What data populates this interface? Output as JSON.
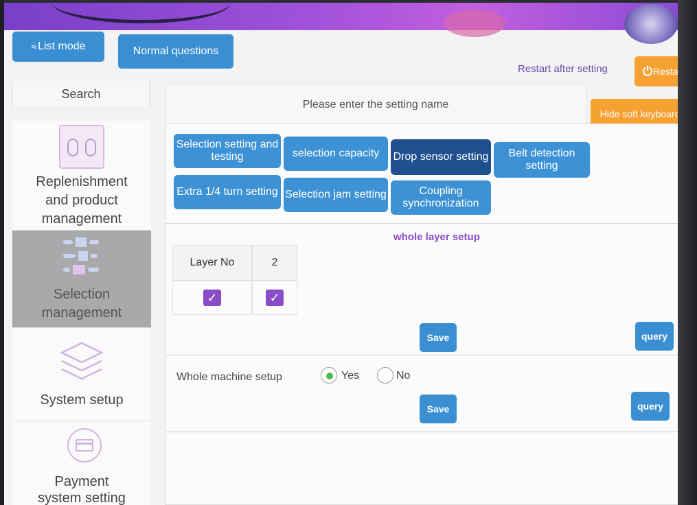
{
  "header": {
    "list_mode_label": "List mode",
    "normal_questions_label": "Normal questions",
    "restart_hint": "Restart after setting",
    "restart_label": "Restart",
    "hide_keyboard_label": "Hide soft keyboard"
  },
  "search": {
    "label": "Search",
    "placeholder": "Please enter the setting name"
  },
  "sidebar": {
    "items": [
      {
        "label": "Replenishment and product management",
        "icon": "device-icon"
      },
      {
        "label": "Selection management",
        "icon": "slots-icon",
        "active": true
      },
      {
        "label": "System setup",
        "icon": "layers-icon"
      },
      {
        "label": "Payment system setting",
        "icon": "card-icon"
      }
    ]
  },
  "tabs": [
    {
      "label": "Selection setting and testing"
    },
    {
      "label": "selection capacity"
    },
    {
      "label": "Drop sensor setting",
      "active": true
    },
    {
      "label": "Belt detection setting"
    },
    {
      "label": "Extra 1/4 turn setting"
    },
    {
      "label": "Selection jam setting"
    },
    {
      "label": "Coupling synchronization"
    }
  ],
  "layer_section": {
    "title": "whole layer setup",
    "col_header": "Layer No",
    "col_value": "2",
    "save_label": "Save",
    "query_label": "query"
  },
  "machine_section": {
    "label": "Whole machine setup",
    "yes_label": "Yes",
    "no_label": "No",
    "selected": "Yes",
    "save_label": "Save",
    "query_label": "query"
  },
  "colors": {
    "accent_blue": "#3a8fd3",
    "active_tab": "#1f4f8f",
    "orange": "#f5a233",
    "purple": "#8a4bc7"
  }
}
